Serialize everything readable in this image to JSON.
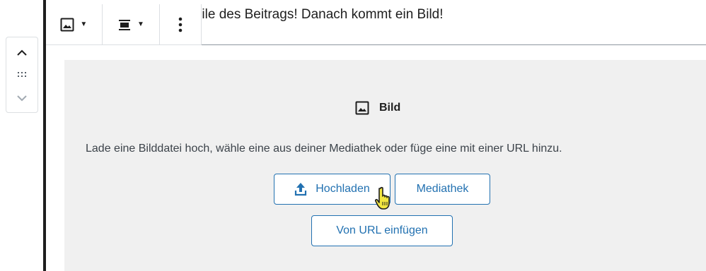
{
  "colors": {
    "accent": "#2271b1",
    "panel_bg": "#f0f0f0",
    "text": "#1e1e1e",
    "muted": "#3c434a",
    "border": "#dcdfe2"
  },
  "paragraph": {
    "text": "extzeile des Beitrags! Danach kommt ein Bild!"
  },
  "toolbar": {
    "image_type_icon": "image-icon",
    "align_icon": "align-center-icon",
    "more_icon": "more-vertical-icon"
  },
  "mover": {
    "up_icon": "chevron-up-icon",
    "drag_icon": "drag-handle-icon",
    "down_icon": "chevron-down-icon"
  },
  "placeholder": {
    "icon": "image-icon",
    "title": "Bild",
    "instructions": "Lade eine Bilddatei hoch, wähle eine aus deiner Mediathek oder füge eine mit einer URL hinzu.",
    "upload_label": "Hochladen",
    "upload_icon": "upload-icon",
    "media_label": "Mediathek",
    "url_label": "Von URL einfügen"
  },
  "cursor": {
    "icon": "hand-pointer-icon"
  }
}
